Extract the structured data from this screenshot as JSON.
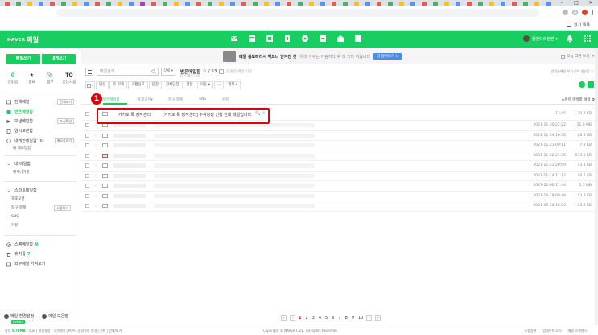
{
  "browser": {
    "tab_colors": [
      "#e8453c",
      "#34a853",
      "#fbbc05",
      "#4285f4",
      "#e8453c",
      "#34a853",
      "#fbbc05",
      "#4285f4",
      "#e8453c",
      "#34a853",
      "#fbbc05",
      "#4285f4",
      "#9c27b0",
      "#e8453c",
      "#34a853",
      "#fbbc05",
      "#4285f4",
      "#e8453c",
      "#34a853",
      "#fbbc05",
      "#4285f4",
      "#e8453c",
      "#34a853",
      "#fbbc05",
      "#4285f4",
      "#e8453c",
      "#34a853",
      "#fbbc05",
      "#4285f4",
      "#e8453c",
      "#34a853",
      "#fbbc05",
      "#4285f4",
      "#e8453c",
      "#34a853",
      "#fbbc05",
      "#4285f4",
      "#e8453c",
      "#34a853",
      "#fbbc05",
      "#4285f4",
      "#e8453c",
      "#34a853",
      "#fbbc05",
      "#4285f4",
      "#e8453c",
      "#34a853",
      "#fbbc05",
      "#4285f4"
    ],
    "reading_list": "읽기 목록"
  },
  "header": {
    "logo_brand": "NAVER",
    "logo_app": "메일",
    "user_name": "줄안다리정받 ▾",
    "brand_color": "#19ce60"
  },
  "sidebar": {
    "compose": "메일쓰기",
    "self_compose": "내게쓰기",
    "quick": [
      {
        "top": "0",
        "label": "안읽음"
      },
      {
        "top": "★",
        "label": "중요"
      },
      {
        "top": "📎",
        "label": "첨부"
      },
      {
        "top": "TO",
        "label": "받는사람"
      }
    ],
    "mailboxes": [
      {
        "label": "전체메일",
        "action": "전체보기",
        "icon": "all-mail-icon"
      },
      {
        "label": "받은메일함",
        "count": "0",
        "icon": "inbox-icon"
      },
      {
        "label": "보낸메일함",
        "action": "수신확인",
        "icon": "sent-icon"
      },
      {
        "label": "임시보관함",
        "icon": "draft-icon"
      },
      {
        "label": "내게쓴메일함",
        "count": "(6)",
        "action": "메모장보기",
        "icon": "self-mail-icon"
      }
    ],
    "self_sub": "내 메모장함",
    "my_mailbox_title": "내 메일함",
    "my_mailbox_sub": "명주니가좋",
    "smart_title": "스마트메일함",
    "smart_items": [
      {
        "label": "프로모션"
      },
      {
        "label": "청구·결제",
        "action": "사용하기"
      },
      {
        "label": "SNS"
      },
      {
        "label": "커뮤"
      }
    ],
    "bottom_boxes": [
      {
        "label": "스팸메일함",
        "count": "N",
        "icon": "spam-icon"
      },
      {
        "label": "휴지통",
        "count": "7",
        "icon": "trash-icon"
      },
      {
        "label": "외부메일 가져오기",
        "icon": "external-mail-icon"
      }
    ],
    "env_settings": "메일 환경설정",
    "mail_manual": "메일 도움말",
    "event_badge": "EVENT"
  },
  "main": {
    "banner": {
      "title": "메일 용도따라서 짝으니 담겨진 것",
      "subtitle": "우리 식구는 어림하다 후 이 기다 하옵니다",
      "button": "더 알아보기 >",
      "dismiss": "오늘 그만 보기"
    },
    "search": {
      "placeholder": "메일검색",
      "detail": "상세 ▾",
      "folder": "받은메일함",
      "unread": "0",
      "total": "/ 53",
      "sub": "전원은 메일 다운",
      "desc": "받은 메일 내림",
      "right": "안읽은메일 보기 전체 안읽음 ⓘ"
    },
    "toolbar": [
      {
        "label": "읽음"
      },
      {
        "label": "휴 삭제"
      },
      {
        "label": "스팸신고"
      },
      {
        "label": "답장"
      },
      {
        "label": "전체답장"
      },
      {
        "label": "전달"
      },
      {
        "label": "이동 ▾"
      },
      {
        "label": "⋯"
      },
      {
        "label": "필터 ▾"
      }
    ],
    "filters": [
      "받은메일함",
      "프로모션▾",
      "청구·결제",
      "SNS",
      "커뮤"
    ],
    "filter_right": "스마트 메일함 설정 ⚙",
    "first_mail": {
      "sender": "카카오 톡 정적센터",
      "subject": "[카카오 톡 정적센터] 수작정정 신청 안내 메일입니다.",
      "icons": "🔍 ✉",
      "date": "13:45",
      "size": "20.7 KB"
    },
    "mails": [
      {
        "date": "2021-11-30 22:22",
        "size": "11.9 MB",
        "red": false
      },
      {
        "date": "2021-11-24 16:36",
        "size": "28.8 KB",
        "red": false
      },
      {
        "date": "2021-11-23 09:11",
        "size": "7.9 KB",
        "red": false
      },
      {
        "date": "2021-11-22 21:36",
        "size": "933.9 KB",
        "red": true
      },
      {
        "date": "2021-11-22 20:09",
        "size": "13.8 KB",
        "red": false
      },
      {
        "date": "2021-11-14 11:12",
        "size": "40.7 KB",
        "red": false
      },
      {
        "date": "2021-11-06 17:44",
        "size": "1.3 MB",
        "red": false
      },
      {
        "date": "2021-10-28 09:48",
        "size": "13.3 KB",
        "red": false
      },
      {
        "date": "2021-09-28 18:03",
        "size": "24.2 KB",
        "red": false
      }
    ],
    "step_marker": "1",
    "pages": [
      "1",
      "2",
      "3",
      "4",
      "5",
      "6",
      "7",
      "8",
      "9",
      "10"
    ],
    "current_page": "1"
  },
  "footer": {
    "left_prefix": "용량 ",
    "capacity": "5.76MB",
    "left_rest": " / 5GB | 환경설정 | 고객센터 | POP3 환경설정 안내 | 전화 | 안내/보기",
    "copyright": "Copyright © NAVER Corp. All Rights Reserved.",
    "links": [
      "스팸정책",
      "업데이트 소식",
      "메일 고객센터"
    ]
  }
}
